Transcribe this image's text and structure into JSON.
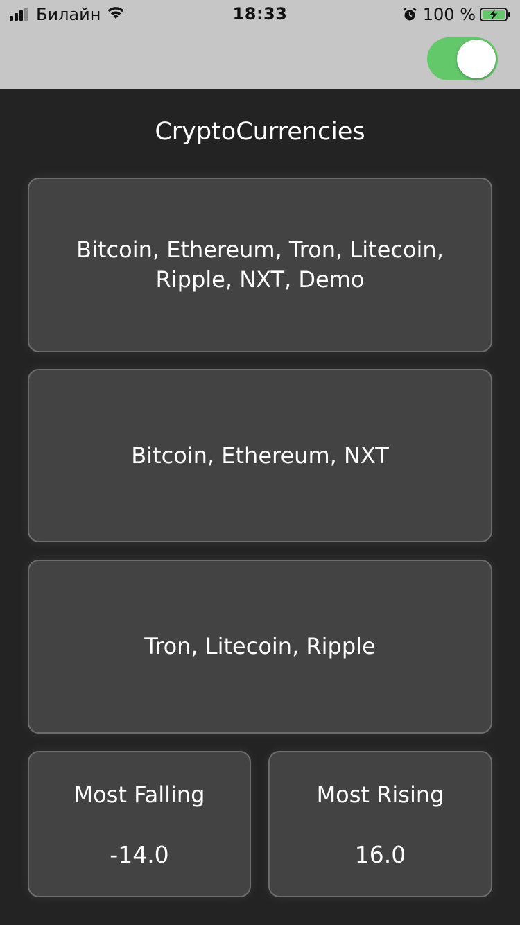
{
  "status_bar": {
    "carrier": "Билайн",
    "time": "18:33",
    "battery_percent": "100 %",
    "signal_bars_filled": 3,
    "signal_bars_total": 4,
    "battery_level": 1.0,
    "charging": true,
    "icons": [
      "signal-icon",
      "wifi-icon",
      "alarm-icon",
      "battery-icon"
    ]
  },
  "header": {
    "toggle_on": true,
    "toggle_color": "#63c86a"
  },
  "page": {
    "title": "CryptoCurrencies"
  },
  "groups": [
    {
      "label": "Bitcoin, Ethereum, Tron, Litecoin, Ripple, NXT, Demo"
    },
    {
      "label": "Bitcoin, Ethereum, NXT"
    },
    {
      "label": "Tron, Litecoin, Ripple"
    }
  ],
  "stats": {
    "most_falling": {
      "label": "Most Falling",
      "value": "-14.0"
    },
    "most_rising": {
      "label": "Most Rising",
      "value": "16.0"
    }
  },
  "colors": {
    "background": "#232323",
    "header": "#c6c6c6",
    "card": "#434343",
    "card_border": "#6c6c6c",
    "accent": "#63c86a"
  }
}
